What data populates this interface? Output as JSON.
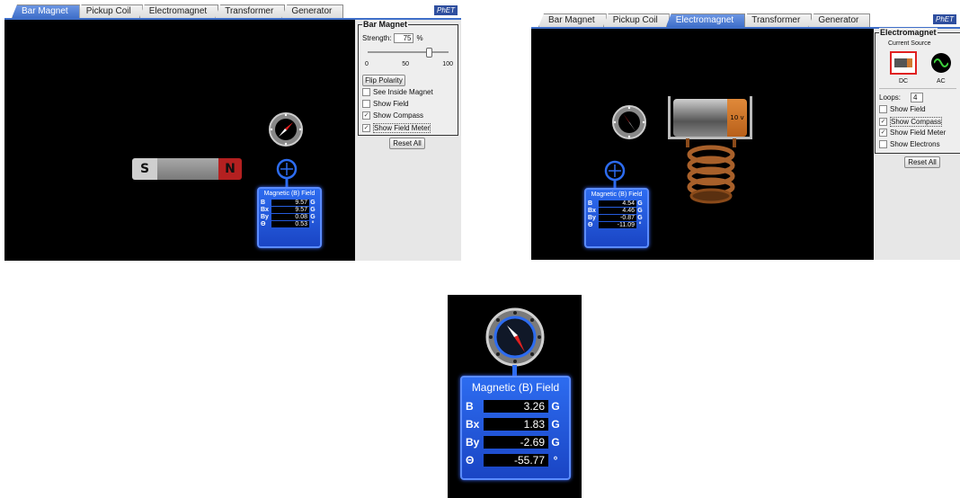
{
  "tabs": [
    "Bar Magnet",
    "Pickup Coil",
    "Electromagnet",
    "Transformer",
    "Generator"
  ],
  "colors": {
    "meter_blue": "#2d6cf0",
    "tab_active": "#3f6fc9",
    "magnet_north": "#b42020",
    "compass_needle": "#e02020"
  },
  "panel_bar_magnet": {
    "active_tab": "Bar Magnet",
    "magnet": {
      "south": "S",
      "north": "N"
    },
    "controls": {
      "group_title": "Bar Magnet",
      "strength_label": "Strength:",
      "strength_value": "75",
      "strength_unit": "%",
      "slider_ticks": [
        "0",
        "50",
        "100"
      ],
      "strength_fraction": 0.75,
      "flip_polarity": "Flip Polarity",
      "see_inside": "See Inside Magnet",
      "show_field": "Show Field",
      "show_compass": "Show Compass",
      "show_field_meter": "Show Field Meter",
      "reset_all": "Reset All"
    },
    "meter": {
      "title": "Magnetic (B) Field",
      "rows": [
        {
          "label": "B",
          "value": "9.57",
          "unit": "G"
        },
        {
          "label": "Bx",
          "value": "9.57",
          "unit": "G"
        },
        {
          "label": "By",
          "value": "0.08",
          "unit": "G"
        },
        {
          "label": "Θ",
          "value": "0.53",
          "unit": "°"
        }
      ]
    }
  },
  "panel_electromagnet": {
    "active_tab": "Electromagnet",
    "battery_label": "10 v",
    "controls": {
      "group_title": "Electromagnet",
      "current_source": "Current Source",
      "dc": "DC",
      "ac": "AC",
      "loops_label": "Loops:",
      "loops_value": "4",
      "show_field": "Show Field",
      "show_compass": "Show Compass",
      "show_field_meter": "Show Field Meter",
      "show_electrons": "Show Electrons",
      "reset_all": "Reset All"
    },
    "meter": {
      "title": "Magnetic (B) Field",
      "rows": [
        {
          "label": "B",
          "value": "4.54",
          "unit": "G"
        },
        {
          "label": "Bx",
          "value": "4.46",
          "unit": "G"
        },
        {
          "label": "By",
          "value": "-0.87",
          "unit": "G"
        },
        {
          "label": "Θ",
          "value": "-11.09",
          "unit": "°"
        }
      ]
    }
  },
  "panel_zoom": {
    "meter": {
      "title": "Magnetic (B) Field",
      "rows": [
        {
          "label": "B",
          "value": "3.26",
          "unit": "G"
        },
        {
          "label": "Bx",
          "value": "1.83",
          "unit": "G"
        },
        {
          "label": "By",
          "value": "-2.69",
          "unit": "G"
        },
        {
          "label": "Θ",
          "value": "-55.77",
          "unit": "°"
        }
      ]
    }
  }
}
